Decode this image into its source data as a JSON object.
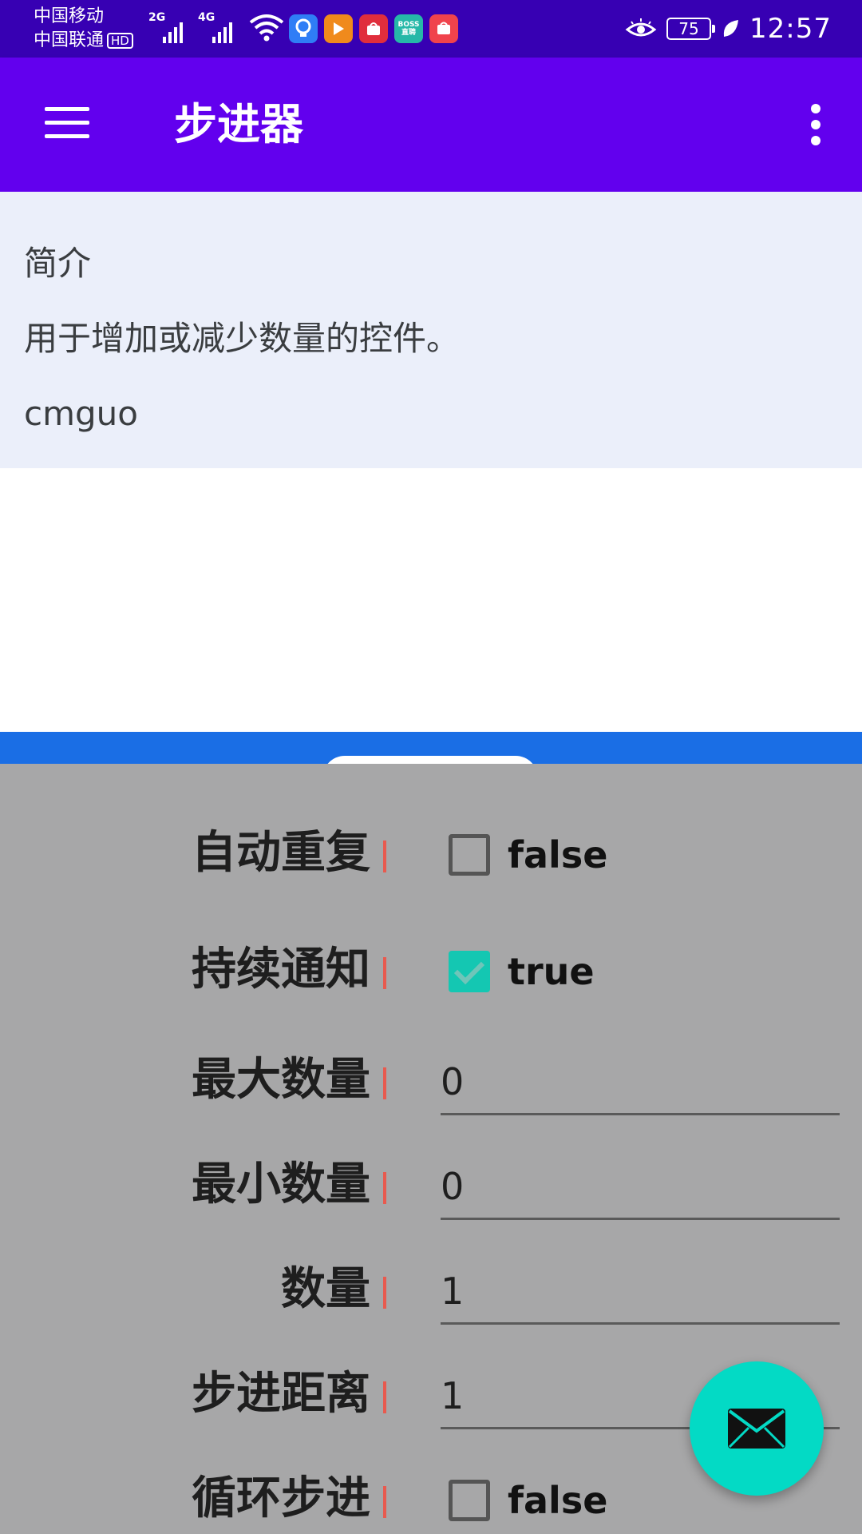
{
  "status_bar": {
    "carrier_1": "中国移动",
    "carrier_2": "中国联通",
    "hd_badge": "HD",
    "network_1": "2G",
    "network_2": "4G",
    "app_icons": [
      "lightbulb-app-icon",
      "video-app-icon",
      "tmall-app-icon",
      "boss-app-icon",
      "huawei-app-icon"
    ],
    "boss_label": "BOSS直聘",
    "battery": "75",
    "time": "12:57"
  },
  "app_bar": {
    "title": "步进器"
  },
  "intro": {
    "heading": "简介",
    "description": "用于增加或减少数量的控件。",
    "author": "cmguo"
  },
  "controls": {
    "auto_repeat": {
      "label": "自动重复",
      "value": "false",
      "checked": false
    },
    "continuous_notify": {
      "label": "持续通知",
      "value": "true",
      "checked": true
    },
    "max_count": {
      "label": "最大数量",
      "value": "0"
    },
    "min_count": {
      "label": "最小数量",
      "value": "0"
    },
    "count": {
      "label": "数量",
      "value": "1"
    },
    "step_distance": {
      "label": "步进距离",
      "value": "1"
    },
    "loop_step": {
      "label": "循环步进",
      "value": "false",
      "checked": false
    }
  },
  "colors": {
    "status_bar": "#3700b3",
    "app_bar": "#6200ee",
    "intro_background": "#ebeffa",
    "panel_background": "#a7a7a8",
    "accent": "#03dac5",
    "divider": "#e85a4f",
    "strip": "#1a6ee5"
  }
}
